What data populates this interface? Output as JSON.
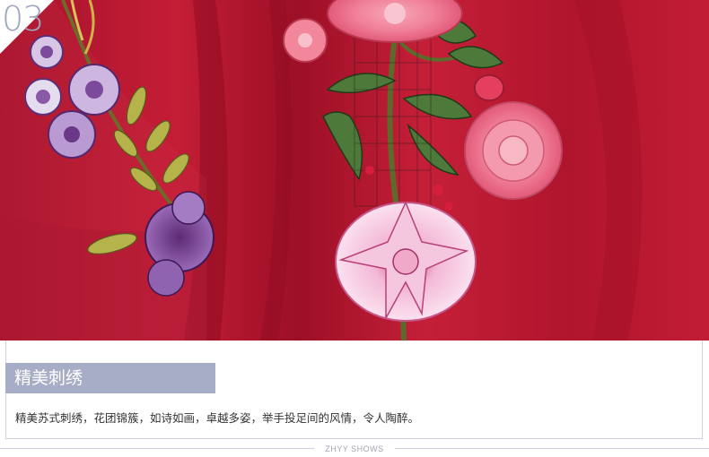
{
  "photo": {
    "section_number": "03",
    "subject": "embroidered-red-fabric"
  },
  "section": {
    "title": "精美刺绣",
    "description": "精美苏式刺绣，花团锦簇，如诗如画，卓越多姿，举手投足间的风情，令人陶醉。"
  },
  "footer": {
    "brand": "ZHYY SHOWS"
  },
  "colors": {
    "fabric_red": "#b8182f",
    "accent_lavender": "#a7adc7",
    "border": "#cfd2dc",
    "text": "#333333"
  }
}
